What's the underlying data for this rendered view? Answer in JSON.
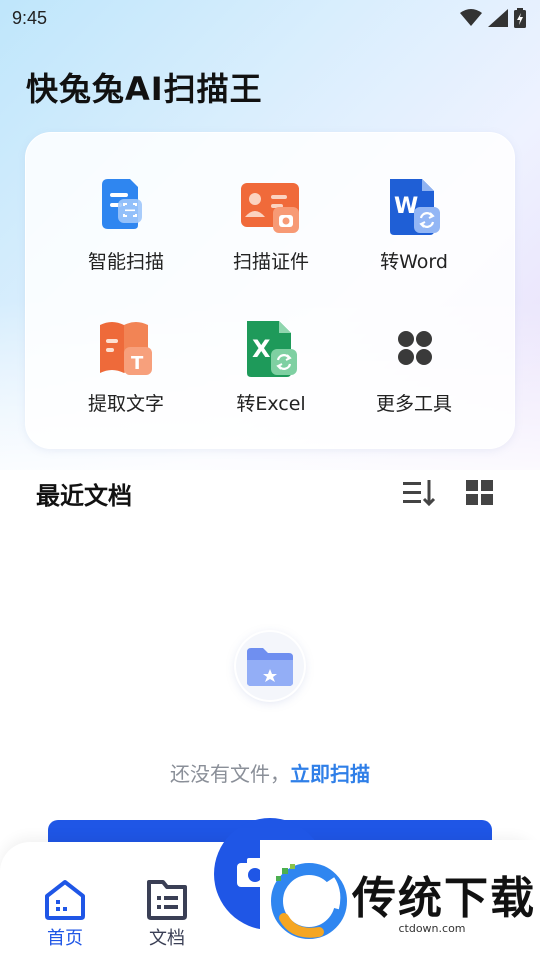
{
  "status_bar": {
    "time": "9:45"
  },
  "app": {
    "title": "快兔兔AI扫描王"
  },
  "tools": [
    {
      "label": "智能扫描",
      "icon": "smart-scan-icon"
    },
    {
      "label": "扫描证件",
      "icon": "id-card-scan-icon"
    },
    {
      "label": "转Word",
      "icon": "word-convert-icon"
    },
    {
      "label": "提取文字",
      "icon": "text-extract-icon"
    },
    {
      "label": "转Excel",
      "icon": "excel-convert-icon"
    },
    {
      "label": "更多工具",
      "icon": "more-tools-icon"
    }
  ],
  "recent": {
    "title": "最近文档",
    "empty_text": "还没有文件，",
    "empty_link": "立即扫描"
  },
  "bottom_nav": {
    "home_label": "首页",
    "docs_label": "文档"
  },
  "watermark": {
    "brand": "传统下载",
    "url": "ctdown.com"
  },
  "colors": {
    "primary": "#1f56e6",
    "link": "#2f7fe8",
    "word_blue": "#1f5fd6",
    "excel_green": "#1e9a5a",
    "orange": "#ef6a3c"
  }
}
